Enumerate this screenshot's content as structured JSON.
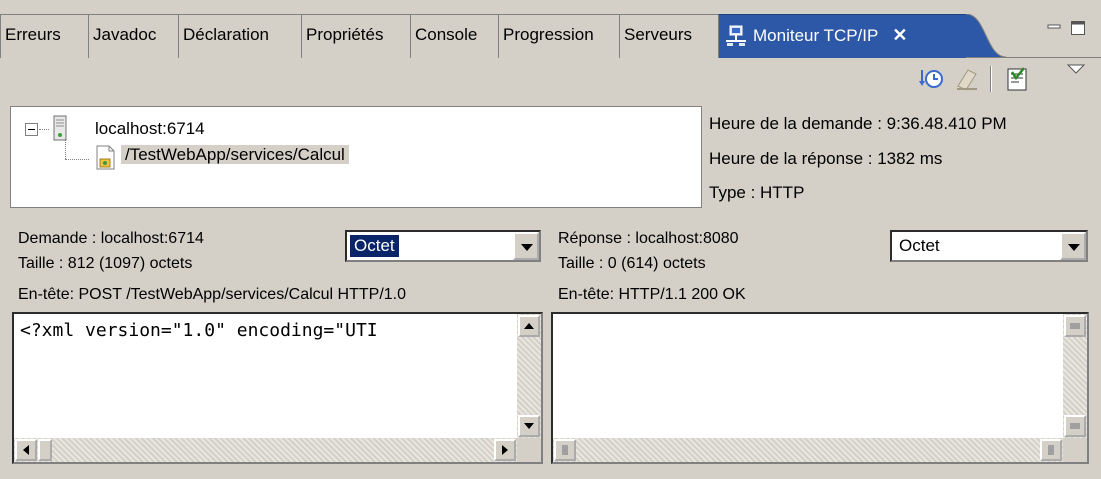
{
  "tabs": [
    {
      "label": "Erreurs"
    },
    {
      "label": "Javadoc"
    },
    {
      "label": "Déclaration"
    },
    {
      "label": "Propriétés"
    },
    {
      "label": "Console"
    },
    {
      "label": "Progression"
    },
    {
      "label": "Serveurs"
    },
    {
      "label": "Moniteur TCP/IP",
      "active": true
    }
  ],
  "tree": {
    "root": "localhost:6714",
    "child": "/TestWebApp/services/Calcul"
  },
  "info": {
    "request_time": "Heure de la demande : 9:36.48.410 PM",
    "response_time": "Heure de la réponse : 1382 ms",
    "type": "Type : HTTP"
  },
  "request": {
    "title": "Demande : localhost:6714",
    "size": "Taille : 812 (1097) octets",
    "header": "En-tête: POST /TestWebApp/services/Calcul HTTP/1.0",
    "encoding": "Octet",
    "body": "<?xml version=\"1.0\" encoding=\"UTI"
  },
  "response": {
    "title": "Réponse : localhost:8080",
    "size": "Taille : 0 (614) octets",
    "header": "En-tête: HTTP/1.1 200 OK",
    "encoding": "Octet"
  },
  "colors": {
    "active_tab": "#2d58a8",
    "selection": "#0a246a",
    "chrome": "#d4d0c8"
  },
  "icons": [
    "tcp-monitor-icon",
    "close-icon",
    "minimize-icon",
    "maximize-icon",
    "clear-history-icon",
    "eraser-icon",
    "properties-icon",
    "view-menu-icon",
    "server-icon",
    "web-resource-icon",
    "collapse-icon"
  ]
}
